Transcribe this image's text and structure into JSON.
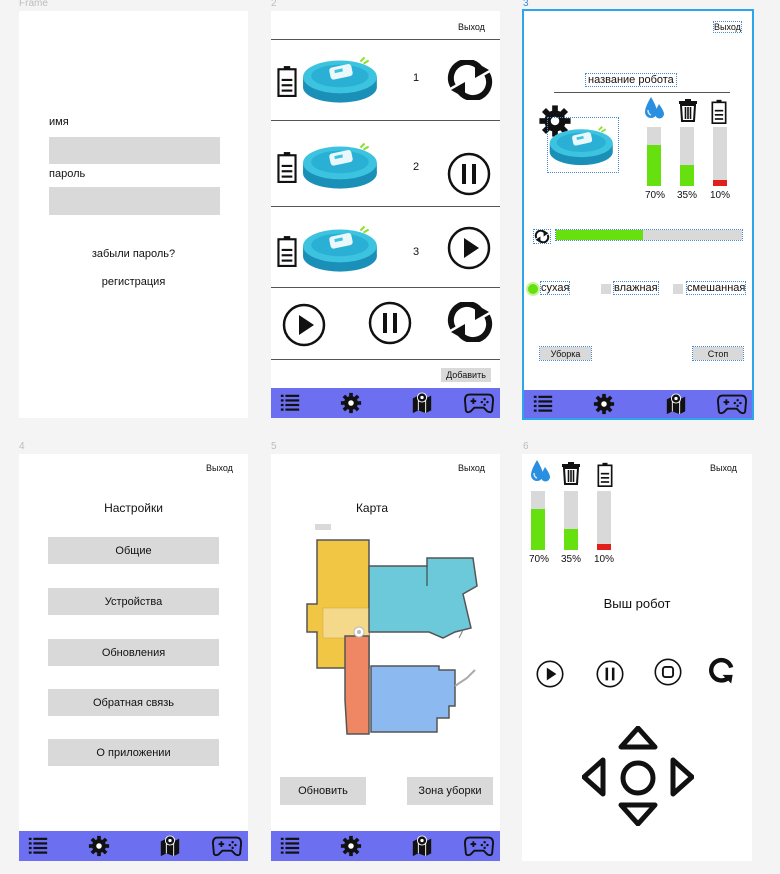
{
  "frames": {
    "f1": {
      "label": "Frame",
      "name_label": "имя",
      "password_label": "пароль",
      "forgot_link": "забыли пароль?",
      "register_link": "регистрация"
    },
    "f2": {
      "label": "2",
      "exit": "Выход",
      "robots": [
        {
          "number": "1",
          "action": "refresh-icon"
        },
        {
          "number": "2",
          "action": "pause-icon"
        },
        {
          "number": "3",
          "action": "play-icon"
        }
      ],
      "add_button": "Добавить"
    },
    "f3": {
      "label": "3",
      "exit": "Выход",
      "robot_name": "название робота",
      "levels": [
        {
          "icon": "water-drop-icon",
          "value": 70,
          "text": "70%",
          "color": "#66e10f"
        },
        {
          "icon": "trash-icon",
          "value": 35,
          "text": "35%",
          "color": "#66e10f"
        },
        {
          "icon": "battery-icon",
          "value": 10,
          "text": "10%",
          "color": "#e0201b"
        }
      ],
      "progress": 0.47,
      "modes": {
        "dry": "сухая",
        "wet": "влажная",
        "mixed": "смешанная"
      },
      "clean_button": "Уборка",
      "stop_button": "Стоп"
    },
    "f4": {
      "label": "4",
      "exit": "Выход",
      "title": "Настройки",
      "items": [
        "Общие",
        "Устройства",
        "Обновления",
        "Обратная связь",
        "О приложении"
      ]
    },
    "f5": {
      "label": "5",
      "exit": "Выход",
      "title": "Карта",
      "refresh_button": "Обновить",
      "zone_button": "Зона уборки"
    },
    "f6": {
      "label": "6",
      "exit": "Выход",
      "levels": [
        {
          "icon": "water-drop-icon",
          "value": 70,
          "text": "70%",
          "color": "#66e10f"
        },
        {
          "icon": "trash-icon",
          "value": 35,
          "text": "35%",
          "color": "#66e10f"
        },
        {
          "icon": "battery-icon",
          "value": 10,
          "text": "10%",
          "color": "#e0201b"
        }
      ],
      "title": "Выш робот"
    }
  },
  "colors": {
    "nav": "#6b6ff0",
    "accent_green": "#66e10f",
    "danger": "#e0201b",
    "field": "#d9d9d9"
  }
}
